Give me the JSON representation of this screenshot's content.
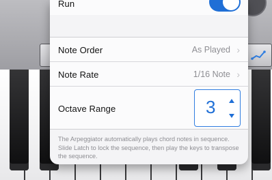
{
  "popover": {
    "run": {
      "label": "Run",
      "enabled": true
    },
    "note_order": {
      "label": "Note Order",
      "value": "As Played"
    },
    "note_rate": {
      "label": "Note Rate",
      "value": "1/16 Note"
    },
    "octave_range": {
      "label": "Octave Range",
      "value": "3"
    },
    "chevron": "›",
    "footer": "The Arpeggiator automatically plays chord notes in sequence. Slide Latch to lock the sequence, then play the keys to transpose the sequence."
  },
  "colors": {
    "accent": "#1f6fd6",
    "secondary_text": "#8e8e93",
    "popover_bg": "#f4f4f6"
  },
  "icons": {
    "toolbar_right": "arpeggiator-icon",
    "stepper_up": "triangle-up-icon",
    "stepper_down": "triangle-down-icon"
  }
}
